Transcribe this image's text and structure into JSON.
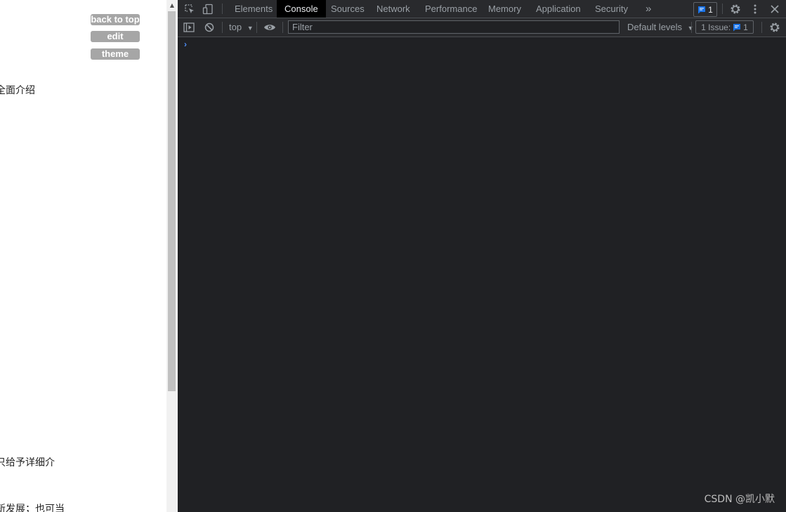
{
  "page": {
    "buttons": {
      "back_to_top": "back to top",
      "edit": "edit",
      "theme": "theme"
    },
    "text_lines": [
      "全面介绍",
      "只给予详细介",
      "新发展；也可当"
    ]
  },
  "devtools": {
    "tabs": [
      "Elements",
      "Console",
      "Sources",
      "Network",
      "Performance",
      "Memory",
      "Application",
      "Security"
    ],
    "active_tab": "Console",
    "more_tabs_glyph": "»",
    "issues_badge_count": "1",
    "toolbar": {
      "context": "top",
      "filter_placeholder": "Filter",
      "levels": "Default levels",
      "issues_label": "1 Issue:",
      "issues_count": "1"
    },
    "console_prompt": "›",
    "colors": {
      "bg": "#202124",
      "toolbar": "#292a2d",
      "accent": "#4d90fe",
      "issue_blue": "#1a73e8"
    }
  },
  "watermark": "CSDN @凯小默"
}
